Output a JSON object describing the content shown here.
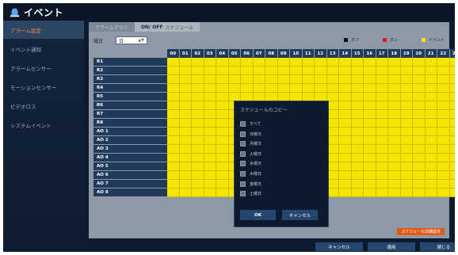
{
  "window": {
    "title": "イベント",
    "icon": "event-bell-icon"
  },
  "sidebar": {
    "items": [
      {
        "label": "アラーム設定",
        "active": true
      },
      {
        "label": "イベント通知",
        "active": false
      },
      {
        "label": "アラームセンサー",
        "active": false
      },
      {
        "label": "モーションセンサー",
        "active": false
      },
      {
        "label": "ビデオロス",
        "active": false
      },
      {
        "label": "システムイベント",
        "active": false
      }
    ]
  },
  "tabs": [
    {
      "label": "アラームアウト",
      "active": false
    },
    {
      "label": "ON/ OFF",
      "sub": "スケジュール",
      "active": true
    }
  ],
  "day": {
    "label": "曜日",
    "value": "日"
  },
  "legend": [
    {
      "label": "オフ",
      "color": "#111111"
    },
    {
      "label": "オン",
      "color": "#e0162b"
    },
    {
      "label": "イベント",
      "color": "#f5e600"
    }
  ],
  "hours": [
    "00",
    "01",
    "02",
    "03",
    "04",
    "05",
    "06",
    "07",
    "08",
    "09",
    "10",
    "11",
    "12",
    "13",
    "14",
    "15",
    "16",
    "17",
    "18",
    "19",
    "20",
    "21",
    "22",
    "23"
  ],
  "rows": [
    "R1",
    "R2",
    "R3",
    "R4",
    "R5",
    "R6",
    "R7",
    "R8",
    "AO 1",
    "AO 2",
    "AO 3",
    "AO 4",
    "AO 5",
    "AO 6",
    "AO 7",
    "AO 8"
  ],
  "cell_state": "event",
  "dialog": {
    "title": "スケジュールのコピー",
    "options": [
      "すべて",
      "日曜日",
      "月曜日",
      "火曜日",
      "水曜日",
      "木曜日",
      "金曜日",
      "土曜日"
    ],
    "ok": "OK",
    "cancel": "キャンセル"
  },
  "schedule_button": "スケジュール詳細設定",
  "footer": {
    "cancel": "キャンセル",
    "apply": "適用",
    "close": "閉じる"
  },
  "colors": {
    "grid_fill": "#f5e600",
    "header_bg": "#223a5b",
    "accent": "#e05a12"
  }
}
